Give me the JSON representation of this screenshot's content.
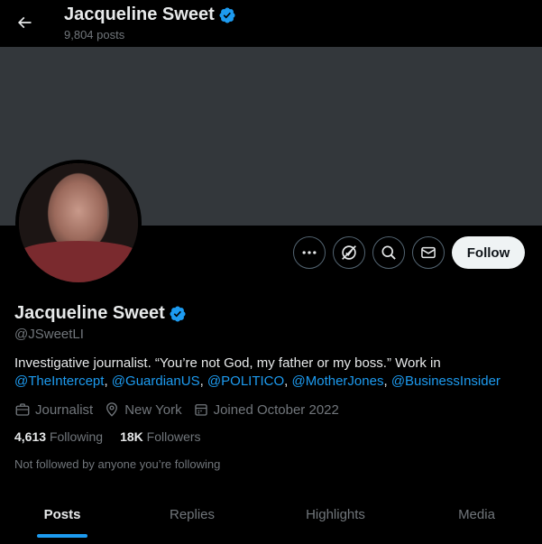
{
  "header": {
    "name": "Jacqueline Sweet",
    "posts": "9,804 posts"
  },
  "profile": {
    "display_name": "Jacqueline Sweet",
    "handle": "@JSweetLI",
    "bio_text": "Investigative journalist. “You’re not God, my father or my boss.” Work in",
    "bio_mentions": [
      "@TheIntercept",
      "@GuardianUS",
      "@POLITICO",
      "@MotherJones",
      "@BusinessInsider"
    ],
    "bio_separator": ", ",
    "category": "Journalist",
    "location": "New York",
    "joined": "Joined October 2022",
    "following_count": "4,613",
    "following_label": "Following",
    "followers_count": "18K",
    "followers_label": "Followers",
    "not_followed_text": "Not followed by anyone you’re following"
  },
  "actions": {
    "follow_label": "Follow",
    "icons": [
      "more-icon",
      "subscribe-icon",
      "search-icon",
      "message-icon"
    ]
  },
  "tabs": [
    {
      "label": "Posts",
      "active": true
    },
    {
      "label": "Replies",
      "active": false
    },
    {
      "label": "Highlights",
      "active": false
    },
    {
      "label": "Media",
      "active": false
    }
  ],
  "colors": {
    "background": "#000000",
    "banner": "#33373b",
    "accent": "#1d9bf0",
    "text_primary": "#e7e9ea",
    "text_secondary": "#71767b",
    "follow_bg": "#eff3f4"
  }
}
